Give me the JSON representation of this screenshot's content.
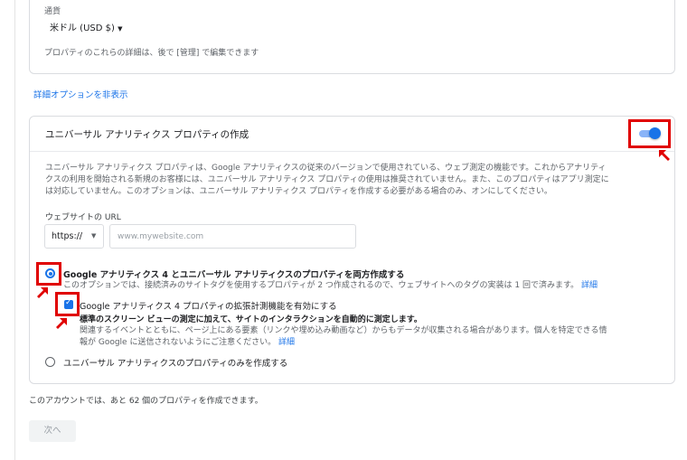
{
  "currency": {
    "label": "通貨",
    "value": "米ドル (USD $)",
    "note": "プロパティのこれらの詳細は、後で [管理] で編集できます"
  },
  "advanced_link": "詳細オプションを非表示",
  "ua_card": {
    "title": "ユニバーサル アナリティクス プロパティの作成",
    "toggle_on": true,
    "description_lines": [
      "ユニバーサル アナリティクス プロパティは、Google アナリティクスの従来のバージョンで使用されている、ウェブ測定の機能です。これからアナリティ",
      "クスの利用を開始される新規のお客様には、ユニバーサル アナリティクス プロパティの使用は推奨されていません。また、このプロパティはアプリ測定に",
      "は対応していません。このオプションは、ユニバーサル アナリティクス プロパティを作成する必要がある場合のみ、オンにしてください。"
    ],
    "url_label": "ウェブサイトの URL",
    "protocol": "https://",
    "url_placeholder": "www.mywebsite.com",
    "option_both": {
      "label": "Google アナリティクス 4 とユニバーサル アナリティクスのプロパティを両方作成する",
      "desc": "このオプションでは、接続済みのサイトタグを使用するプロパティが 2 つ作成されるので、ウェブサイトへのタグの実装は 1 回で済みます。",
      "link": "詳細",
      "selected": true
    },
    "enhanced": {
      "label": "Google アナリティクス 4 プロパティの拡張計測機能を有効にする",
      "bold_desc": "標準のスクリーン ビューの測定に加えて、サイトのインタラクションを自動的に測定します。",
      "desc_line1": "関連するイベントとともに、ページ上にある要素（リンクや埋め込み動画など）からもデータが収集される場合があります。個人を特定できる情",
      "desc_line2": "報が Google に送信されないようにご注意ください。",
      "link": "詳細",
      "checked": true
    },
    "option_ua_only": {
      "label": "ユニバーサル アナリティクスのプロパティのみを作成する",
      "selected": false
    }
  },
  "quota_text": "このアカウントでは、あと 62 個のプロパティを作成できます。",
  "next_button": "次へ",
  "colors": {
    "accent": "#1a73e8",
    "highlight": "#e00000"
  }
}
